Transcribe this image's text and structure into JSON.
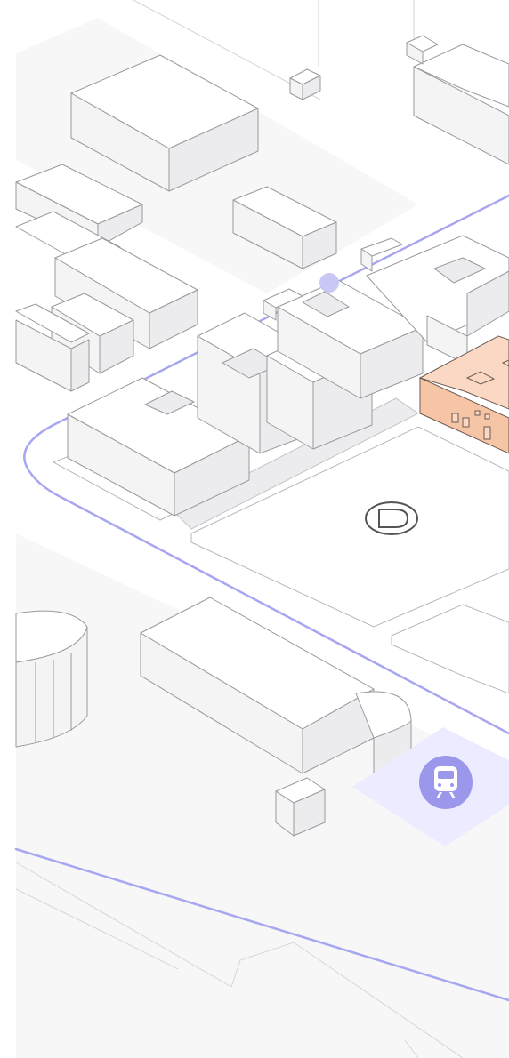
{
  "map": {
    "background": "#ffffff",
    "route_color": "#a7a6f0",
    "highlight_color": "#fad8c3",
    "transit_tile_color": "#ecebff",
    "transit_badge_color": "#9b98ec"
  },
  "markers": {
    "destination": {
      "icon": "destination-d-icon"
    },
    "transit": {
      "icon": "train-icon"
    }
  }
}
